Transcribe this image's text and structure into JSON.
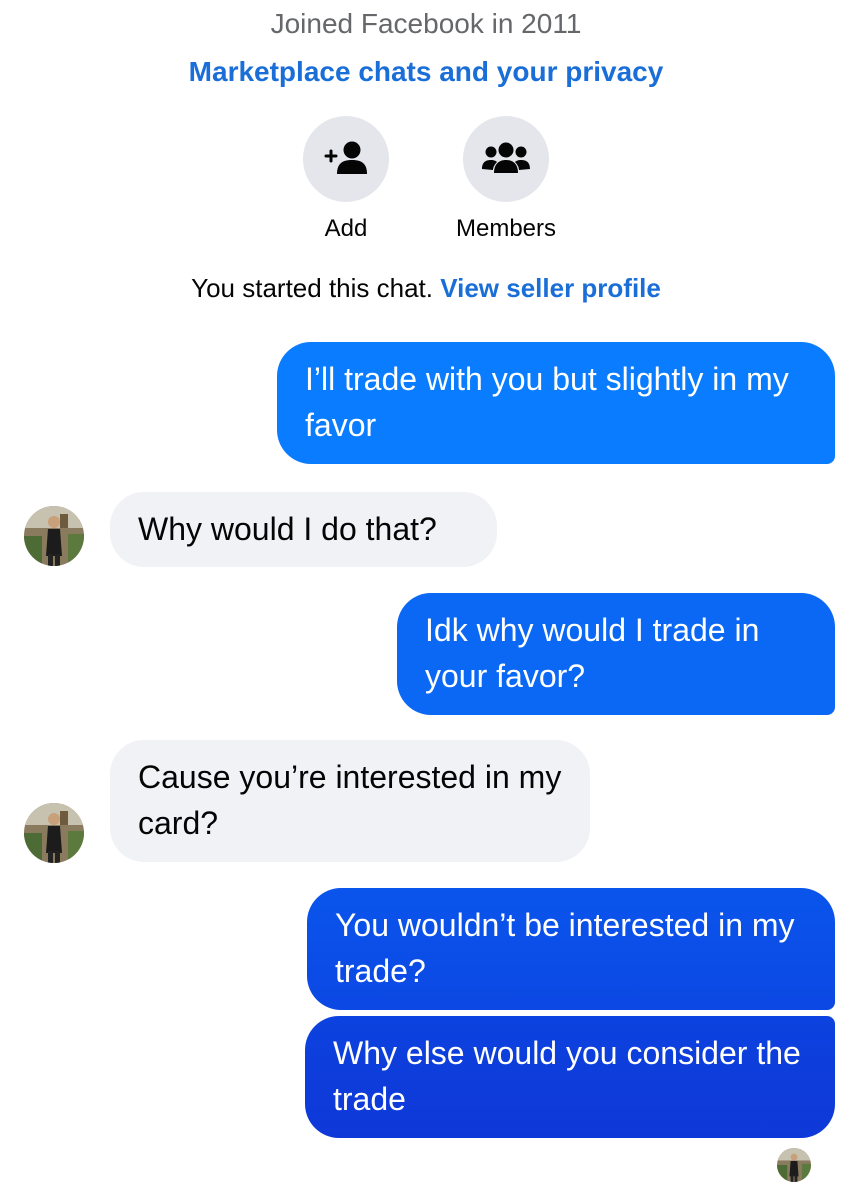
{
  "header": {
    "joined_text": "Joined Facebook in 2011",
    "privacy_link": "Marketplace chats and your privacy"
  },
  "actions": {
    "add_label": "Add",
    "members_label": "Members"
  },
  "info": {
    "started_text": "You started this chat.",
    "seller_link": "View seller profile"
  },
  "messages": [
    {
      "sender": "me",
      "text": "I’ll trade with you but slightly in my favor"
    },
    {
      "sender": "other",
      "text": "Why would I do that?"
    },
    {
      "sender": "me",
      "text": "Idk why would I trade in your favor?"
    },
    {
      "sender": "other",
      "text": "Cause you’re interested in my card?"
    },
    {
      "sender": "me",
      "text": "You wouldn’t be interested in my trade?"
    },
    {
      "sender": "me",
      "text": "Why else would you consider the trade"
    }
  ],
  "colors": {
    "link_blue": "#1a6ed8",
    "outgoing_top": "#0a7cff",
    "outgoing_bottom": "#0f38d8",
    "incoming_bg": "#f0f2f5",
    "action_circle_bg": "#e4e6eb",
    "muted_text": "#65676b"
  }
}
